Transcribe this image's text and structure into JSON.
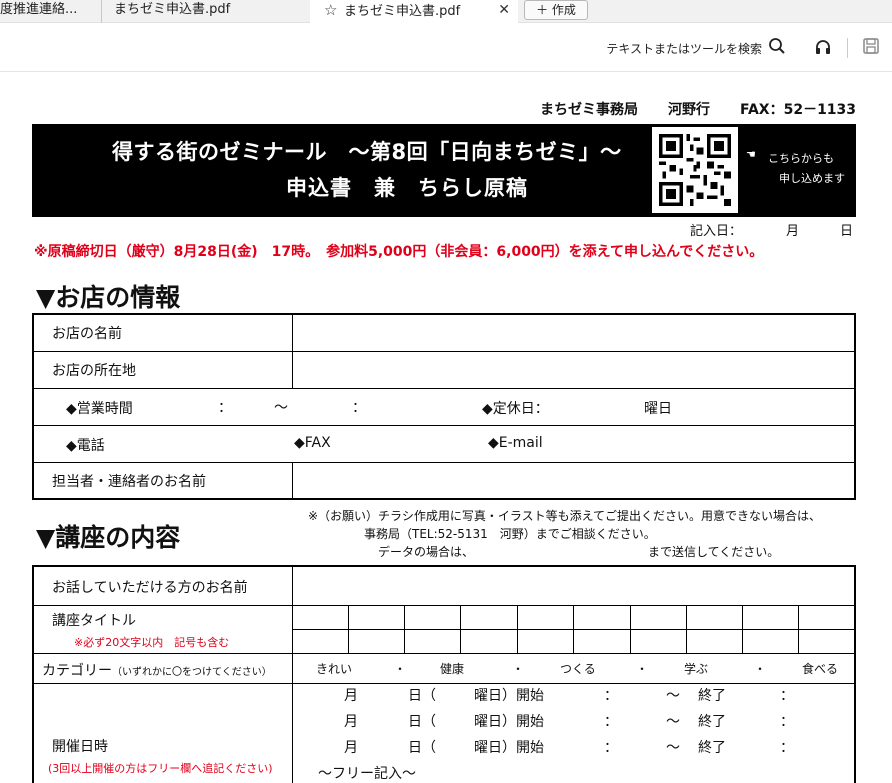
{
  "tabs": [
    {
      "label": "度推進連絡..."
    },
    {
      "label": "まちゼミ申込書.pdf"
    },
    {
      "label": "まちゼミ申込書.pdf",
      "active": true
    }
  ],
  "new_tab": {
    "label": "＋ 作成"
  },
  "toolbar": {
    "search_label": "テキストまたはツールを検索"
  },
  "doc": {
    "office": {
      "name": "まちゼミ事務局",
      "person": "河野行",
      "fax": "FAX：52－1133"
    },
    "banner": {
      "line1": "得する街のゼミナール　～第8回「日向まちゼミ」～",
      "line2": "申込書　兼　ちらし原稿",
      "qr_line1": "こちらからも",
      "qr_line2": "申し込めます"
    },
    "date_line": {
      "label": "記入日：",
      "month": "月",
      "day": "日"
    },
    "deadline": "※原稿締切日（厳守）8月28日(金)　17時。　参加料5,000円（非会員：6,000円）を添えて申し込んでください。",
    "section1": {
      "title": "▼お店の情報",
      "rows": {
        "shop_name": "お店の名前",
        "shop_address": "お店の所在地",
        "hours_label": "◆営業時間",
        "hours_colon1": "：",
        "hours_tilde": "～",
        "hours_colon2": "：",
        "closed_label": "◆定休日：",
        "closed_suffix": "曜日",
        "phone": "◆電話",
        "fax": "◆FAX",
        "email": "◆E-mail",
        "contact": "担当者・連絡者のお名前"
      }
    },
    "section2": {
      "title": "▼講座の内容",
      "notes": [
        "※（お願い）チラシ作成用に写真・イラスト等も添えてご提出ください。用意できない場合は、",
        "事務局（TEL:52-5131　河野）までご相談ください。",
        "データの場合は、　　　　　　　　　　　　　　　まで送信してください。"
      ],
      "rows": {
        "speaker": "お話していただける方のお名前",
        "course_title": "講座タイトル",
        "course_title_note": "※必ず20文字以内　記号も含む",
        "category": "カテゴリー",
        "category_hint": "（いずれかに〇をつけてください）",
        "category_options": [
          "きれい",
          "・",
          "健康",
          "・",
          "つくる",
          "・",
          "学ぶ",
          "・",
          "食べる"
        ],
        "dates": "開催日時",
        "dates_note": "(3回以上開催の方はフリー欄へ追記ください)",
        "schedule_parts": [
          "月",
          "日（",
          "曜日）開始",
          "：",
          "～",
          "終了",
          "："
        ],
        "free_entry": "～フリー記入～"
      }
    }
  }
}
